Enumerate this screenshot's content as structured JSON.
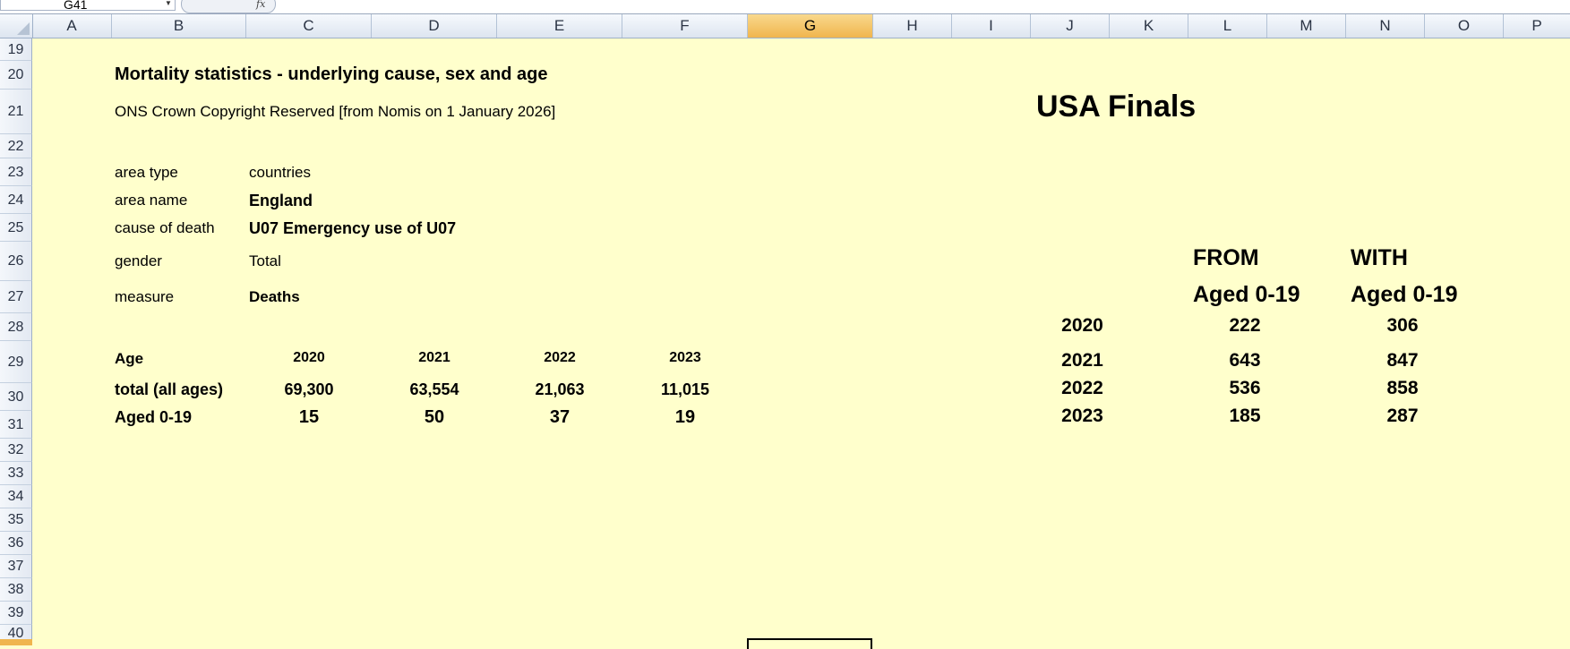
{
  "formula_bar": {
    "name_box": "G41",
    "fx": "fx"
  },
  "columns": [
    "A",
    "B",
    "C",
    "D",
    "E",
    "F",
    "G",
    "H",
    "I",
    "J",
    "K",
    "L",
    "M",
    "N",
    "O",
    "P"
  ],
  "rows": [
    "19",
    "20",
    "21",
    "22",
    "23",
    "24",
    "25",
    "26",
    "27",
    "28",
    "29",
    "30",
    "31",
    "32",
    "33",
    "34",
    "35",
    "36",
    "37",
    "38",
    "39",
    "40"
  ],
  "sheet": {
    "title": "Mortality statistics - underlying cause, sex and age",
    "copyright": "ONS Crown Copyright Reserved [from Nomis on 1 January 2026]",
    "meta": [
      {
        "label": "area type",
        "value": "countries"
      },
      {
        "label": "area name",
        "value": "England"
      },
      {
        "label": "cause of death",
        "value": "U07 Emergency use of U07"
      },
      {
        "label": "gender",
        "value": "Total"
      },
      {
        "label": "measure",
        "value": "Deaths"
      }
    ],
    "table": {
      "header": [
        "Age",
        "2020",
        "2021",
        "2022",
        "2023"
      ],
      "rows": [
        [
          "total (all ages)",
          "69,300",
          "63,554",
          "21,063",
          "11,015"
        ],
        [
          "Aged 0-19",
          "15",
          "50",
          "37",
          "19"
        ]
      ]
    }
  },
  "usa": {
    "title": "USA Finals",
    "from_label": "FROM",
    "with_label": "WITH",
    "from_sub": "Aged 0-19",
    "with_sub": "Aged 0-19",
    "rows": [
      [
        "2020",
        "222",
        "306"
      ],
      [
        "2021",
        "643",
        "847"
      ],
      [
        "2022",
        "536",
        "858"
      ],
      [
        "2023",
        "185",
        "287"
      ]
    ]
  },
  "colors": {
    "sheet_bg": "#ffffcc",
    "active_header": "#f0b54d"
  }
}
